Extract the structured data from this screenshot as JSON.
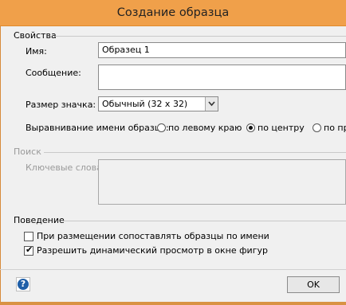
{
  "window": {
    "title": "Создание образца"
  },
  "properties": {
    "section_label": "Свойства",
    "name_label": "Имя:",
    "name_value": "Образец 1",
    "message_label": "Сообщение:",
    "message_value": "",
    "icon_size_label": "Размер значка:",
    "icon_size_value": "Обычный (32 x 32)",
    "alignment_label": "Выравнивание имени образца:",
    "alignment_options": [
      "по левому краю",
      "по центру",
      "по пр"
    ],
    "alignment_selected": "по центру"
  },
  "search": {
    "section_label": "Поиск",
    "keywords_label": "Ключевые слова:",
    "keywords_value": ""
  },
  "behavior": {
    "section_label": "Поведение",
    "match_by_name_label": "При размещении сопоставлять образцы по имени",
    "match_by_name_checked": false,
    "dynamic_preview_label": "Разрешить динамический просмотр в окне фигур",
    "dynamic_preview_checked": true
  },
  "footer": {
    "ok_label": "OK"
  },
  "colors": {
    "titlebar": "#f0a04a",
    "help_icon": "#1f5fa8"
  }
}
